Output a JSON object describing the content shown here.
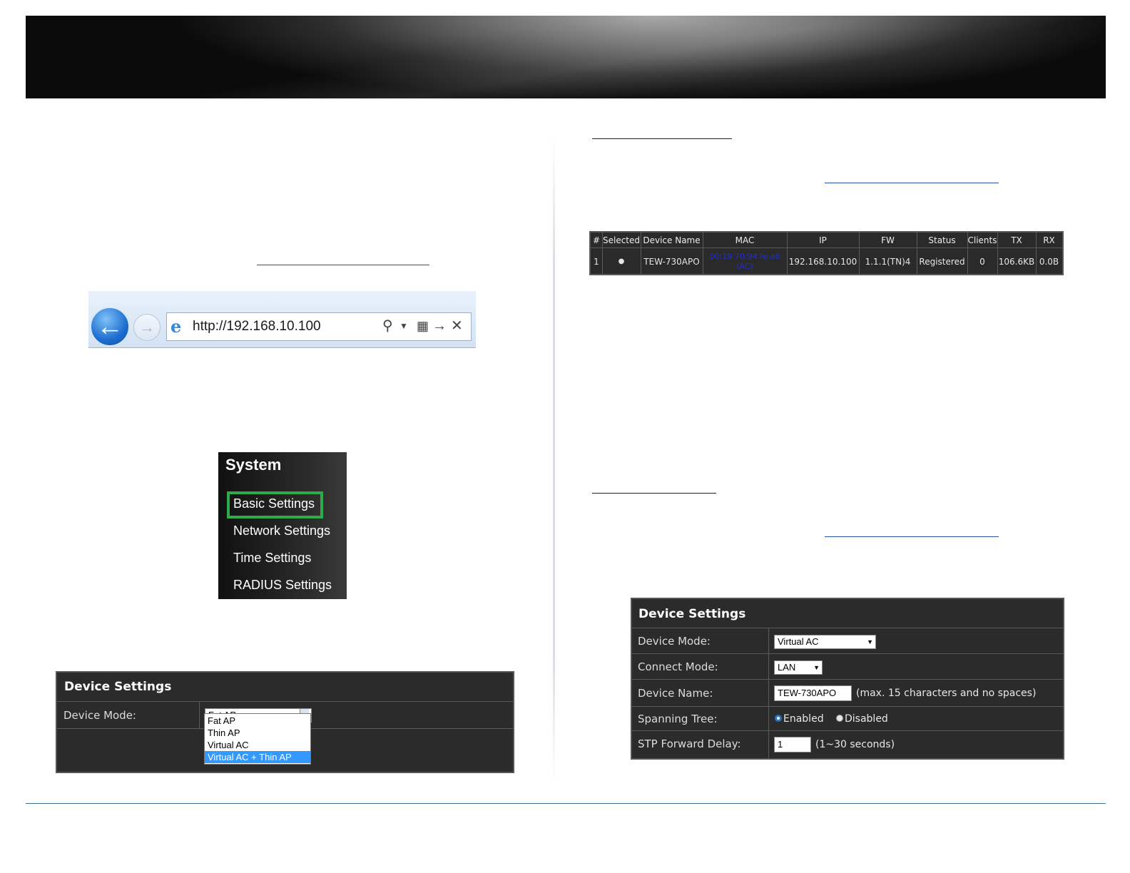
{
  "browser": {
    "url": "http://192.168.10.100",
    "icons": [
      "back-arrow-icon",
      "forward-arrow-icon",
      "ie-logo-icon",
      "search-icon",
      "dropdown-icon",
      "compat-view-icon",
      "go-arrow-icon",
      "close-icon"
    ]
  },
  "system_menu": {
    "title": "System",
    "items": [
      "Basic Settings",
      "Network Settings",
      "Time Settings",
      "RADIUS Settings"
    ],
    "highlight_color": "#2eaa4a"
  },
  "device_settings_small": {
    "title": "Device Settings",
    "mode_label": "Device Mode:",
    "mode_value": "Fat AP",
    "options": [
      "Fat AP",
      "Thin AP",
      "Virtual AC",
      "Virtual AC + Thin AP"
    ],
    "highlighted_option": "Virtual AC + Thin AP"
  },
  "ap_table": {
    "headers": [
      "#",
      "Selected",
      "Device Name",
      "MAC",
      "IP",
      "FW",
      "Status",
      "Clients",
      "TX",
      "RX"
    ],
    "row": {
      "index": "1",
      "selected": "●",
      "device_name": "TEW-730APO",
      "mac": "00:19:70:94:fe:a6",
      "mac_note": "(AC)",
      "ip": "192.168.10.100",
      "fw": "1.1.1(TN)4",
      "status": "Registered",
      "clients": "0",
      "tx": "106.6KB",
      "rx": "0.0B"
    }
  },
  "device_settings_large": {
    "title": "Device Settings",
    "rows": {
      "device_mode": {
        "label": "Device Mode:",
        "value": "Virtual AC"
      },
      "connect_mode": {
        "label": "Connect Mode:",
        "value": "LAN"
      },
      "device_name": {
        "label": "Device Name:",
        "value": "TEW-730APO",
        "hint": "(max. 15 characters and no spaces)"
      },
      "spanning_tree": {
        "label": "Spanning Tree:",
        "enabled": "Enabled",
        "disabled": "Disabled",
        "selected": "Enabled"
      },
      "stp_delay": {
        "label": "STP Forward Delay:",
        "value": "1",
        "hint": "(1~30 seconds)"
      }
    }
  },
  "colors": {
    "link_underline": "#2a4fa8",
    "footer_line": "#3d6b93",
    "panel_bg": "#2b2b2b",
    "mac_text": "#1f2fd0",
    "dropdown_highlight": "#3399ff"
  }
}
